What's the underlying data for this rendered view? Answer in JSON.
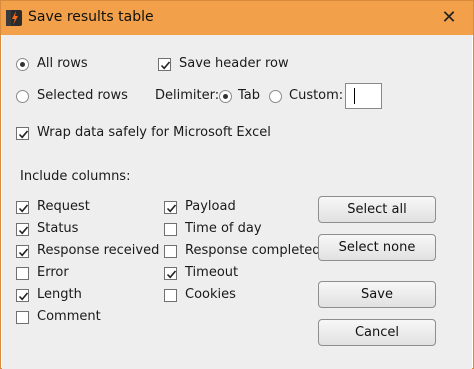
{
  "window": {
    "title": "Save results table",
    "close_glyph": "✕"
  },
  "rows_mode": {
    "all_rows_label": "All rows",
    "selected_rows_label": "Selected rows",
    "selected": "all"
  },
  "save_header_row": {
    "label": "Save header row",
    "checked": true
  },
  "delimiter": {
    "label": "Delimiter:",
    "tab_label": "Tab",
    "custom_label": "Custom:",
    "selected": "tab",
    "custom_value": ""
  },
  "wrap_excel": {
    "label": "Wrap data safely for Microsoft Excel",
    "checked": true
  },
  "columns": {
    "heading": "Include columns:",
    "left": [
      {
        "label": "Request",
        "checked": true
      },
      {
        "label": "Status",
        "checked": true
      },
      {
        "label": "Response received",
        "checked": true
      },
      {
        "label": "Error",
        "checked": false
      },
      {
        "label": "Length",
        "checked": true
      },
      {
        "label": "Comment",
        "checked": false
      }
    ],
    "right": [
      {
        "label": "Payload",
        "checked": true
      },
      {
        "label": "Time of day",
        "checked": false
      },
      {
        "label": "Response completed",
        "checked": false
      },
      {
        "label": "Timeout",
        "checked": true
      },
      {
        "label": "Cookies",
        "checked": false
      }
    ]
  },
  "buttons": {
    "select_all": "Select all",
    "select_none": "Select none",
    "save": "Save",
    "cancel": "Cancel"
  },
  "icons": {
    "app": "burp-lightning-icon",
    "accent": "#f2a14a"
  }
}
